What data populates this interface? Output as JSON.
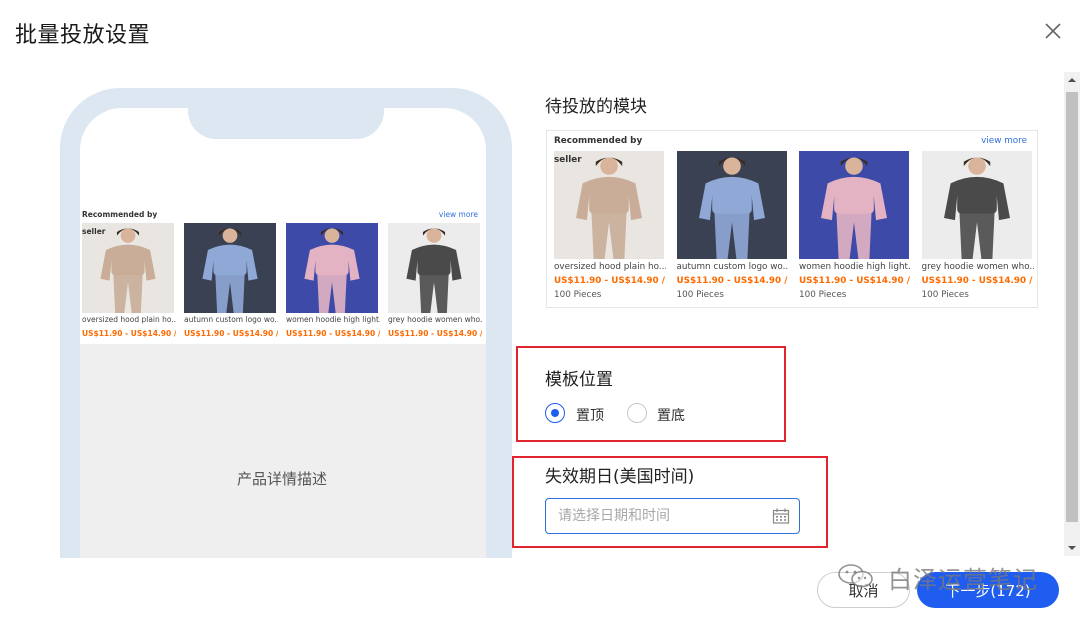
{
  "dialog": {
    "title": "批量投放设置"
  },
  "module": {
    "recommended_label": "Recommended by",
    "seller_label": "seller",
    "view_more": "view more",
    "products": [
      {
        "name": "oversized hood plain ho...",
        "price": "US$11.90 - US$14.90 / ...",
        "moq": "100 Pieces",
        "color": "#c9ad98",
        "bg": "#e9e6e2"
      },
      {
        "name": "autumn custom logo wo...",
        "price": "US$11.90 - US$14.90 / ...",
        "moq": "100 Pieces",
        "color": "#8fa8d6",
        "bg": "#3a4152"
      },
      {
        "name": "women hoodie high light...",
        "price": "US$11.90 - US$14.90 / ...",
        "moq": "100 Pieces",
        "color": "#e3b3c3",
        "bg": "#3d4aa8"
      },
      {
        "name": "grey hoodie women who...",
        "price": "US$11.90 - US$14.90 / ...",
        "moq": "100 Pieces",
        "color": "#4a4a4a",
        "bg": "#ececec"
      }
    ]
  },
  "preview": {
    "detail_text": "产品详情描述"
  },
  "pending_section": {
    "title": "待投放的模块"
  },
  "template_position": {
    "title": "模板位置",
    "options": [
      {
        "label": "置顶",
        "checked": true
      },
      {
        "label": "置底",
        "checked": false
      }
    ]
  },
  "expiry": {
    "title": "失效期日(美国时间)",
    "placeholder": "请选择日期和时间"
  },
  "footer": {
    "cancel_label": "取消",
    "next_label": "下一步(172)"
  },
  "watermark": {
    "text": "白泽运营笔记"
  },
  "colors": {
    "primary": "#1e5df0",
    "highlight_box": "#e1252e",
    "price": "#ff6a00",
    "phone_frame": "#dde7f1"
  }
}
